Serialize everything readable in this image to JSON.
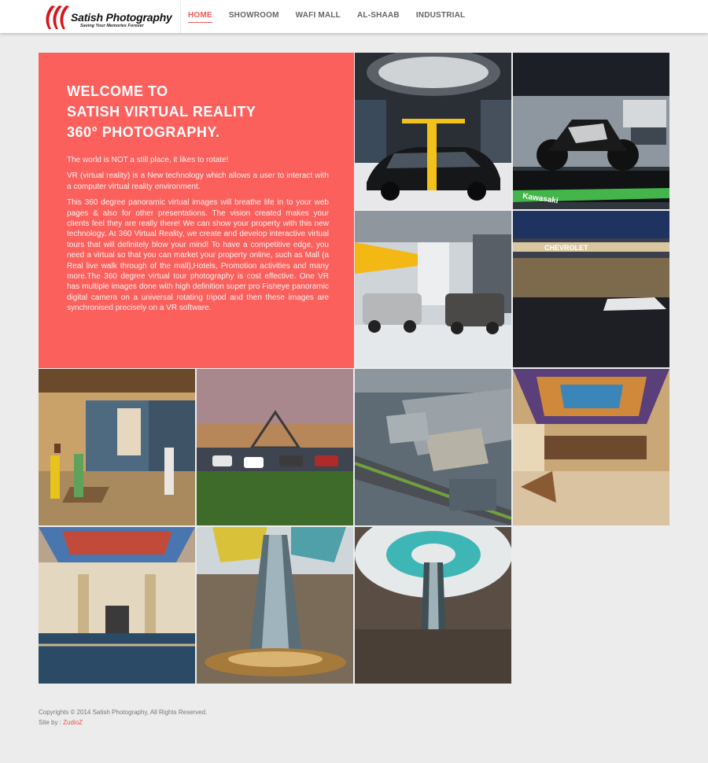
{
  "header": {
    "logo": {
      "title": "Satish Photography",
      "tagline": "Saving Your Memories Forever"
    },
    "nav": [
      {
        "label": "HOME",
        "active": true
      },
      {
        "label": "SHOWROOM",
        "active": false
      },
      {
        "label": "WAFI MALL",
        "active": false
      },
      {
        "label": "AL-SHAAB",
        "active": false
      },
      {
        "label": "INDUSTRIAL",
        "active": false
      }
    ]
  },
  "welcome": {
    "heading": [
      "WELCOME TO",
      "SATISH VIRTUAL REALITY",
      "360° PHOTOGRAPHY."
    ],
    "paragraphs": [
      "The world is NOT a still place, it likes to rotate!",
      "VR (virtual reality) is a New technology which allows a user to interact with a computer virtual reality environment.",
      "This 360 degree panoramic virtual images will breathe life in to your web pages & also for other presentations. The vision created makes your clients feel they are really there! We can show your property with this new technology. At 360 Virtual Reality, we create and develop interactive virtual tours that will definitely blow your mind! To have a competitive edge, you need a virtual so that you can market your property online, such as Mall (a Real live walk through of the mall),Hotels, Promotion activities and many more.The 360 degree virtual tour photography is cost effective. One VR has multiple images done with high definition super pro Fisheye panoramic digital camera on a universal rotating tripod and then these images are synchronised precisely on a VR software."
    ]
  },
  "gallery": {
    "signs": {
      "kawasaki": "Kawasaki",
      "chevrolet": "CHEVROLET"
    }
  },
  "footer": {
    "copyright": "Copyrights © 2014 Satish Photography, All Rights Reserved.",
    "site_by_label": "Site by :",
    "site_by_link": "ZudioZ"
  },
  "colors": {
    "accent": "#fb605d",
    "nav_active": "#ef5b5b",
    "background": "#ececec"
  }
}
